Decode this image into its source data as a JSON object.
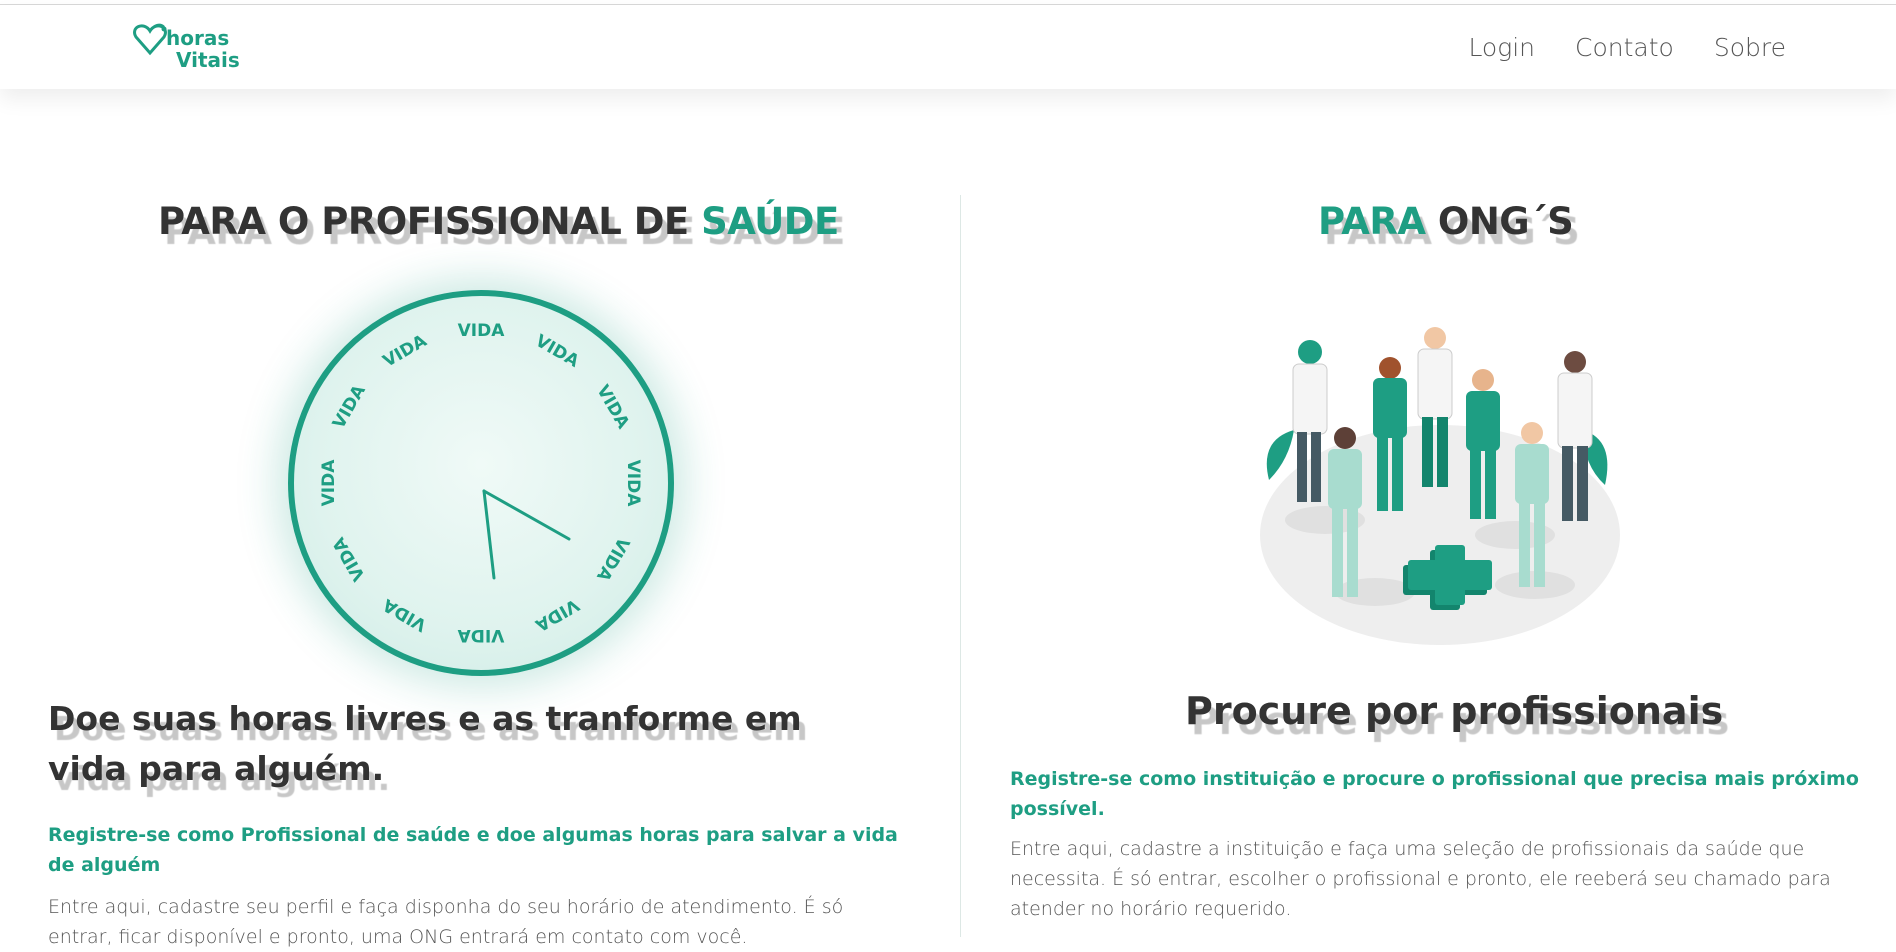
{
  "brand": {
    "line1": "horas",
    "line2": "Vitais",
    "accent_color": "#1e9e83"
  },
  "nav": {
    "items": [
      "Login",
      "Contato",
      "Sobre"
    ]
  },
  "left": {
    "heading_prefix": "PARA O PROFISSIONAL DE ",
    "heading_accent": "SAÚDE",
    "clock_words": [
      "VIDA",
      "VIDA",
      "VIDA",
      "VIDA",
      "VIDA",
      "VIDA",
      "VIDA",
      "VIDA",
      "VIDA",
      "VIDA",
      "VIDA",
      "VIDA"
    ],
    "subheading": "Doe suas horas livres e as tranforme em vida para alguém.",
    "highlight": "Registre-se como Profissional de saúde e doe algumas horas para salvar a vida de alguém",
    "body": "Entre aqui, cadastre seu perfil e faça disponha do seu horário de atendimento. É só entrar, ficar disponível e pronto, uma ONG entrará em contato com você."
  },
  "right": {
    "heading_accent": "PARA",
    "heading_rest": " ONG´S",
    "subheading": "Procure por profissionais",
    "highlight": "Registre-se como instituição e procure o profissional que precisa mais próximo possível.",
    "body": "Entre aqui, cadastre a instituição e faça uma seleção de profissionais da saúde que necessita. É só entrar, escolher o profissional e pronto, ele reeberá seu chamado para atender no horário requerido."
  }
}
